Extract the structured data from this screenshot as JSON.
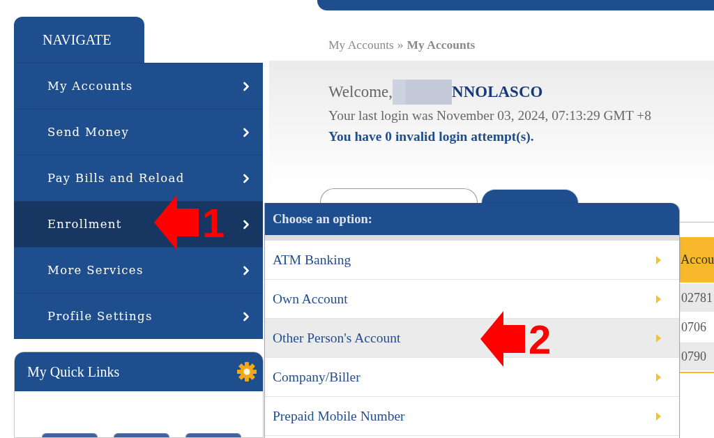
{
  "navigation": {
    "title": "NAVIGATE",
    "items": [
      {
        "label": "My Accounts",
        "selected": false
      },
      {
        "label": "Send Money",
        "selected": false
      },
      {
        "label": "Pay Bills and Reload",
        "selected": false
      },
      {
        "label": "Enrollment",
        "selected": true
      },
      {
        "label": "More Services",
        "selected": false
      },
      {
        "label": "Profile Settings",
        "selected": false
      }
    ]
  },
  "quick_links": {
    "title": "My Quick Links"
  },
  "breadcrumb": {
    "separator": "»",
    "items": [
      {
        "label": "My Accounts",
        "current": false
      },
      {
        "label": "My Accounts",
        "current": true
      }
    ]
  },
  "welcome": {
    "greeting": "Welcome,",
    "name": "NNOLASCO",
    "last_login": "Your last login was November 03, 2024, 07:13:29 GMT +8",
    "invalid_attempts": "You have 0 invalid login attempt(s)."
  },
  "account_tabs": [
    {
      "selected": false
    },
    {
      "selected": true
    }
  ],
  "accounts_table": {
    "column_header": "Accou",
    "rows": [
      "02781",
      "0706",
      "0790"
    ]
  },
  "option_menu": {
    "title": "Choose an option:",
    "items": [
      {
        "label": "ATM Banking",
        "selected": false
      },
      {
        "label": "Own Account",
        "selected": false
      },
      {
        "label": "Other Person's Account",
        "selected": true
      },
      {
        "label": "Company/Biller",
        "selected": false
      },
      {
        "label": "Prepaid Mobile Number",
        "selected": false
      }
    ]
  },
  "annotations": [
    {
      "label": "1"
    },
    {
      "label": "2"
    }
  ]
}
